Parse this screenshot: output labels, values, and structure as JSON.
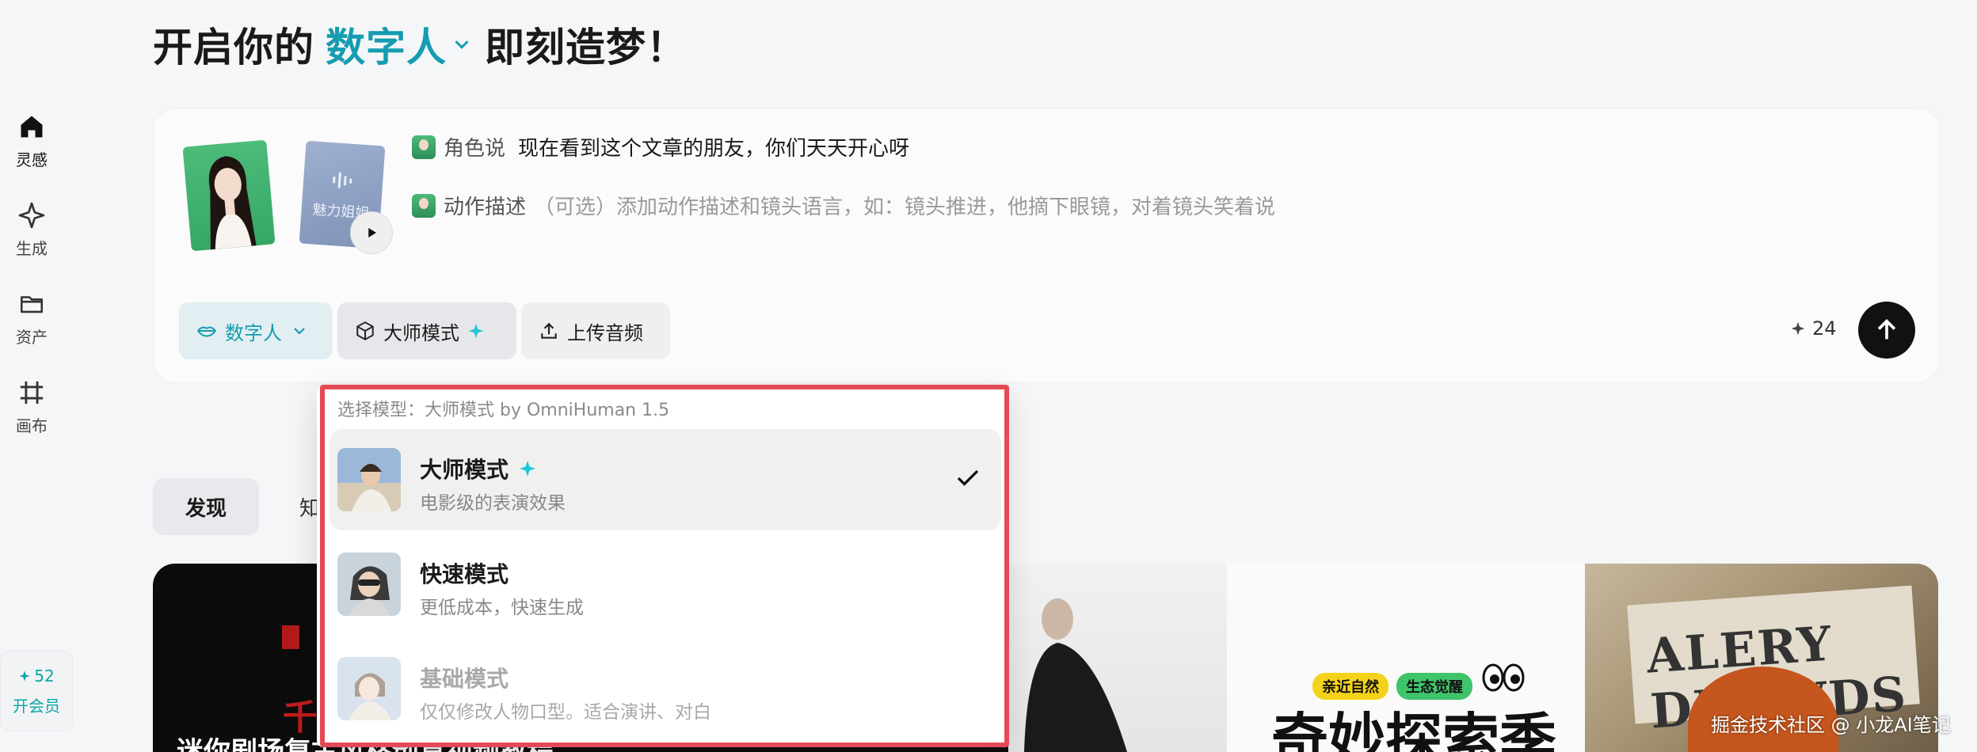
{
  "headline": {
    "prefix": "开启你的",
    "mode": "数字人",
    "suffix": "即刻造梦！"
  },
  "sidebar": {
    "items": [
      {
        "label": "灵感",
        "icon": "home-icon"
      },
      {
        "label": "生成",
        "icon": "sparkle-icon"
      },
      {
        "label": "资产",
        "icon": "folder-icon"
      },
      {
        "label": "画布",
        "icon": "canvas-icon"
      }
    ],
    "credits": "52",
    "member_label": "开会员"
  },
  "composer": {
    "voice_name": "魅力姐姐",
    "role_tag": "角色说",
    "role_text": "现在看到这个文章的朋友，你们天天开心呀",
    "action_tag": "动作描述",
    "action_optional": "（可选）",
    "action_placeholder": "添加动作描述和镜头语言，如：镜头推进，他摘下眼镜，对着镜头笑着说",
    "chip_digital": "数字人",
    "chip_master": "大师模式",
    "chip_upload": "上传音频",
    "credits": "24"
  },
  "tabs": {
    "discover": "发现",
    "partial": "知"
  },
  "dropdown": {
    "title": "选择模型：大师模式 by OmniHuman 1.5",
    "items": [
      {
        "name": "大师模式",
        "desc": "电影级的表演效果",
        "selected": true
      },
      {
        "name": "快速模式",
        "desc": "更低成本，快速生成",
        "selected": false
      },
      {
        "name": "基础模式",
        "desc": "仅仅修改人物口型。适合演讲、对白",
        "selected": false
      }
    ]
  },
  "gallery": {
    "card1_caption": "迷你剧场复古风格创意视频教程",
    "card1_red": "千",
    "card3_pill1": "亲近自然",
    "card3_pill2": "生态觉醒",
    "card3_title": "奇妙探索季",
    "card4_headline": "ALERY DEOWDS"
  },
  "watermark": "掘金技术社区 @ 小龙AI笔记",
  "colors": {
    "accent": "#159cb0",
    "highlight_border": "#e34a55",
    "send_button": "#111111"
  }
}
